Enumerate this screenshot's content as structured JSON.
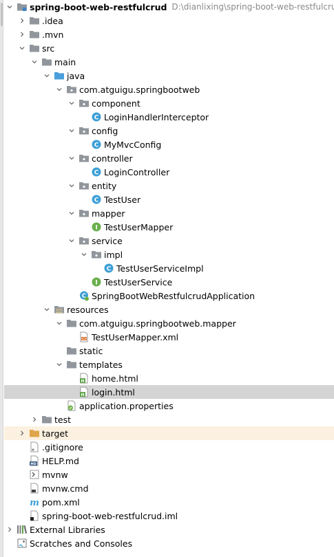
{
  "project": {
    "name": "spring-boot-web-restfulcrud",
    "path": "D:\\dianlixing\\spring-boot-web-restfulcrud"
  },
  "tree": {
    "idea": ".idea",
    "mvn": ".mvn",
    "src": "src",
    "main": "main",
    "java": "java",
    "pkg": "com.atguigu.springbootweb",
    "component": "component",
    "login_handler_interceptor": "LoginHandlerInterceptor",
    "config": "config",
    "my_mvc_config": "MyMvcConfig",
    "controller": "controller",
    "login_controller": "LoginController",
    "entity": "entity",
    "test_user": "TestUser",
    "mapper": "mapper",
    "test_user_mapper": "TestUserMapper",
    "service": "service",
    "impl": "impl",
    "test_user_service_impl": "TestUserServiceImpl",
    "test_user_service": "TestUserService",
    "application_class": "SpringBootWebRestfulcrudApplication",
    "resources": "resources",
    "mapper_pkg": "com.atguigu.springbootweb.mapper",
    "test_user_mapper_xml": "TestUserMapper.xml",
    "static": "static",
    "templates": "templates",
    "home_html": "home.html",
    "login_html": "login.html",
    "application_properties": "application.properties",
    "test": "test",
    "target": "target",
    "gitignore": ".gitignore",
    "help_md": "HELP.md",
    "mvnw": "mvnw",
    "mvnw_cmd": "mvnw.cmd",
    "pom_xml": "pom.xml",
    "iml": "spring-boot-web-restfulcrud.iml",
    "external_libraries": "External Libraries",
    "scratches": "Scratches and Consoles"
  },
  "colors": {
    "selected_row": "#d4d4d4",
    "excluded_row": "#fcf1e0",
    "folder": "#90969c",
    "source_folder": "#4a9edb",
    "resource_folder": "#b6a06c",
    "excluded_folder": "#e0a54a",
    "class_icon": "#3d9fd6",
    "interface_icon": "#6ab04c",
    "path_text": "#8a8a8a"
  },
  "icons": {
    "expanded": "chevron-down-icon",
    "collapsed": "chevron-right-icon",
    "folder": "folder-icon",
    "package": "package-icon",
    "class": "class-icon",
    "interface": "interface-icon",
    "spring_boot_class": "spring-boot-class-icon",
    "xml": "xml-file-icon",
    "html": "html-file-icon",
    "properties": "properties-file-icon",
    "gitignore": "gitignore-file-icon",
    "markdown": "markdown-file-icon",
    "script": "script-file-icon",
    "maven": "maven-file-icon",
    "iml": "iml-file-icon",
    "libraries": "libraries-icon",
    "scratches": "scratches-icon"
  }
}
